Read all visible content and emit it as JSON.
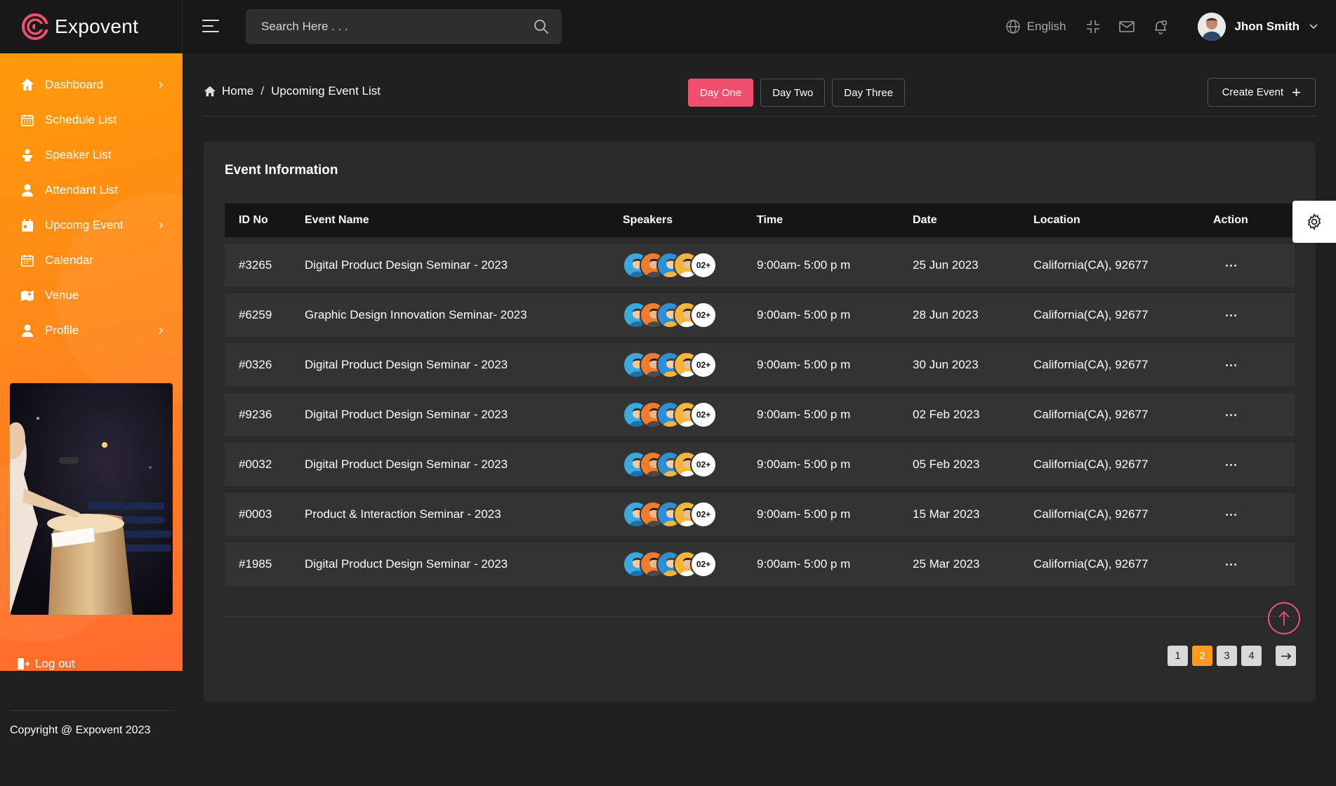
{
  "brand": {
    "name": "Expovent"
  },
  "search": {
    "placeholder": "Search Here . . ."
  },
  "topbar": {
    "language": "English",
    "user_name": "Jhon Smith"
  },
  "sidebar": {
    "items": [
      {
        "label": "Dashboard",
        "icon": "home-icon",
        "has_submenu": true
      },
      {
        "label": "Schedule List",
        "icon": "calendar-grid-icon",
        "has_submenu": false
      },
      {
        "label": "Speaker List",
        "icon": "speaker-icon",
        "has_submenu": false
      },
      {
        "label": "Attendant List",
        "icon": "user-icon",
        "has_submenu": false
      },
      {
        "label": "Upcomg Event",
        "icon": "calendar-event-icon",
        "has_submenu": true
      },
      {
        "label": "Calendar",
        "icon": "calendar-icon",
        "has_submenu": false
      },
      {
        "label": "Venue",
        "icon": "map-icon",
        "has_submenu": false
      },
      {
        "label": "Profile",
        "icon": "profile-icon",
        "has_submenu": true
      }
    ],
    "logout": "Log out"
  },
  "copyright": "Copyright @ Expovent 2023",
  "breadcrumb": {
    "home": "Home",
    "separator": "/",
    "current": "Upcoming Event List"
  },
  "day_tabs": [
    "Day One",
    "Day Two",
    "Day Three"
  ],
  "active_day_tab": "Day One",
  "create_event": "Create Event",
  "card": {
    "title": "Event Information",
    "columns": [
      "ID No",
      "Event Name",
      "Speakers",
      "Time",
      "Date",
      "Location",
      "Action"
    ],
    "rows": [
      {
        "id": "#3265",
        "name": "Digital Product Design Seminar - 2023",
        "speakers_more": "02+",
        "time": "9:00am- 5:00 p m",
        "date": "25 Jun 2023",
        "location": "California(CA), 92677"
      },
      {
        "id": "#6259",
        "name": "Graphic Design Innovation Seminar- 2023",
        "speakers_more": "02+",
        "time": "9:00am- 5:00 p m",
        "date": "28 Jun 2023",
        "location": "California(CA), 92677"
      },
      {
        "id": "#0326",
        "name": "Digital Product Design Seminar - 2023",
        "speakers_more": "02+",
        "time": "9:00am- 5:00 p m",
        "date": "30 Jun 2023",
        "location": "California(CA), 92677"
      },
      {
        "id": "#9236",
        "name": "Digital Product Design Seminar - 2023",
        "speakers_more": "02+",
        "time": "9:00am- 5:00 p m",
        "date": "02 Feb 2023",
        "location": "California(CA), 92677"
      },
      {
        "id": "#0032",
        "name": "Digital Product Design Seminar - 2023",
        "speakers_more": "02+",
        "time": "9:00am- 5:00 p m",
        "date": "05 Feb 2023",
        "location": "California(CA), 92677"
      },
      {
        "id": "#0003",
        "name": "Product & Interaction Seminar - 2023",
        "speakers_more": "02+",
        "time": "9:00am- 5:00 p m",
        "date": "15 Mar 2023",
        "location": "California(CA), 92677"
      },
      {
        "id": "#1985",
        "name": "Digital Product Design Seminar - 2023",
        "speakers_more": "02+",
        "time": "9:00am- 5:00 p m",
        "date": "25 Mar 2023",
        "location": "California(CA), 92677"
      }
    ]
  },
  "pagination": {
    "pages": [
      "1",
      "2",
      "3",
      "4"
    ],
    "active": "2",
    "next": "→"
  },
  "colors": {
    "accent_pink": "#f0506e",
    "accent_orange": "#ff9a1e",
    "bg_dark": "#1f1f1f",
    "card_bg": "#2a2a2a"
  }
}
